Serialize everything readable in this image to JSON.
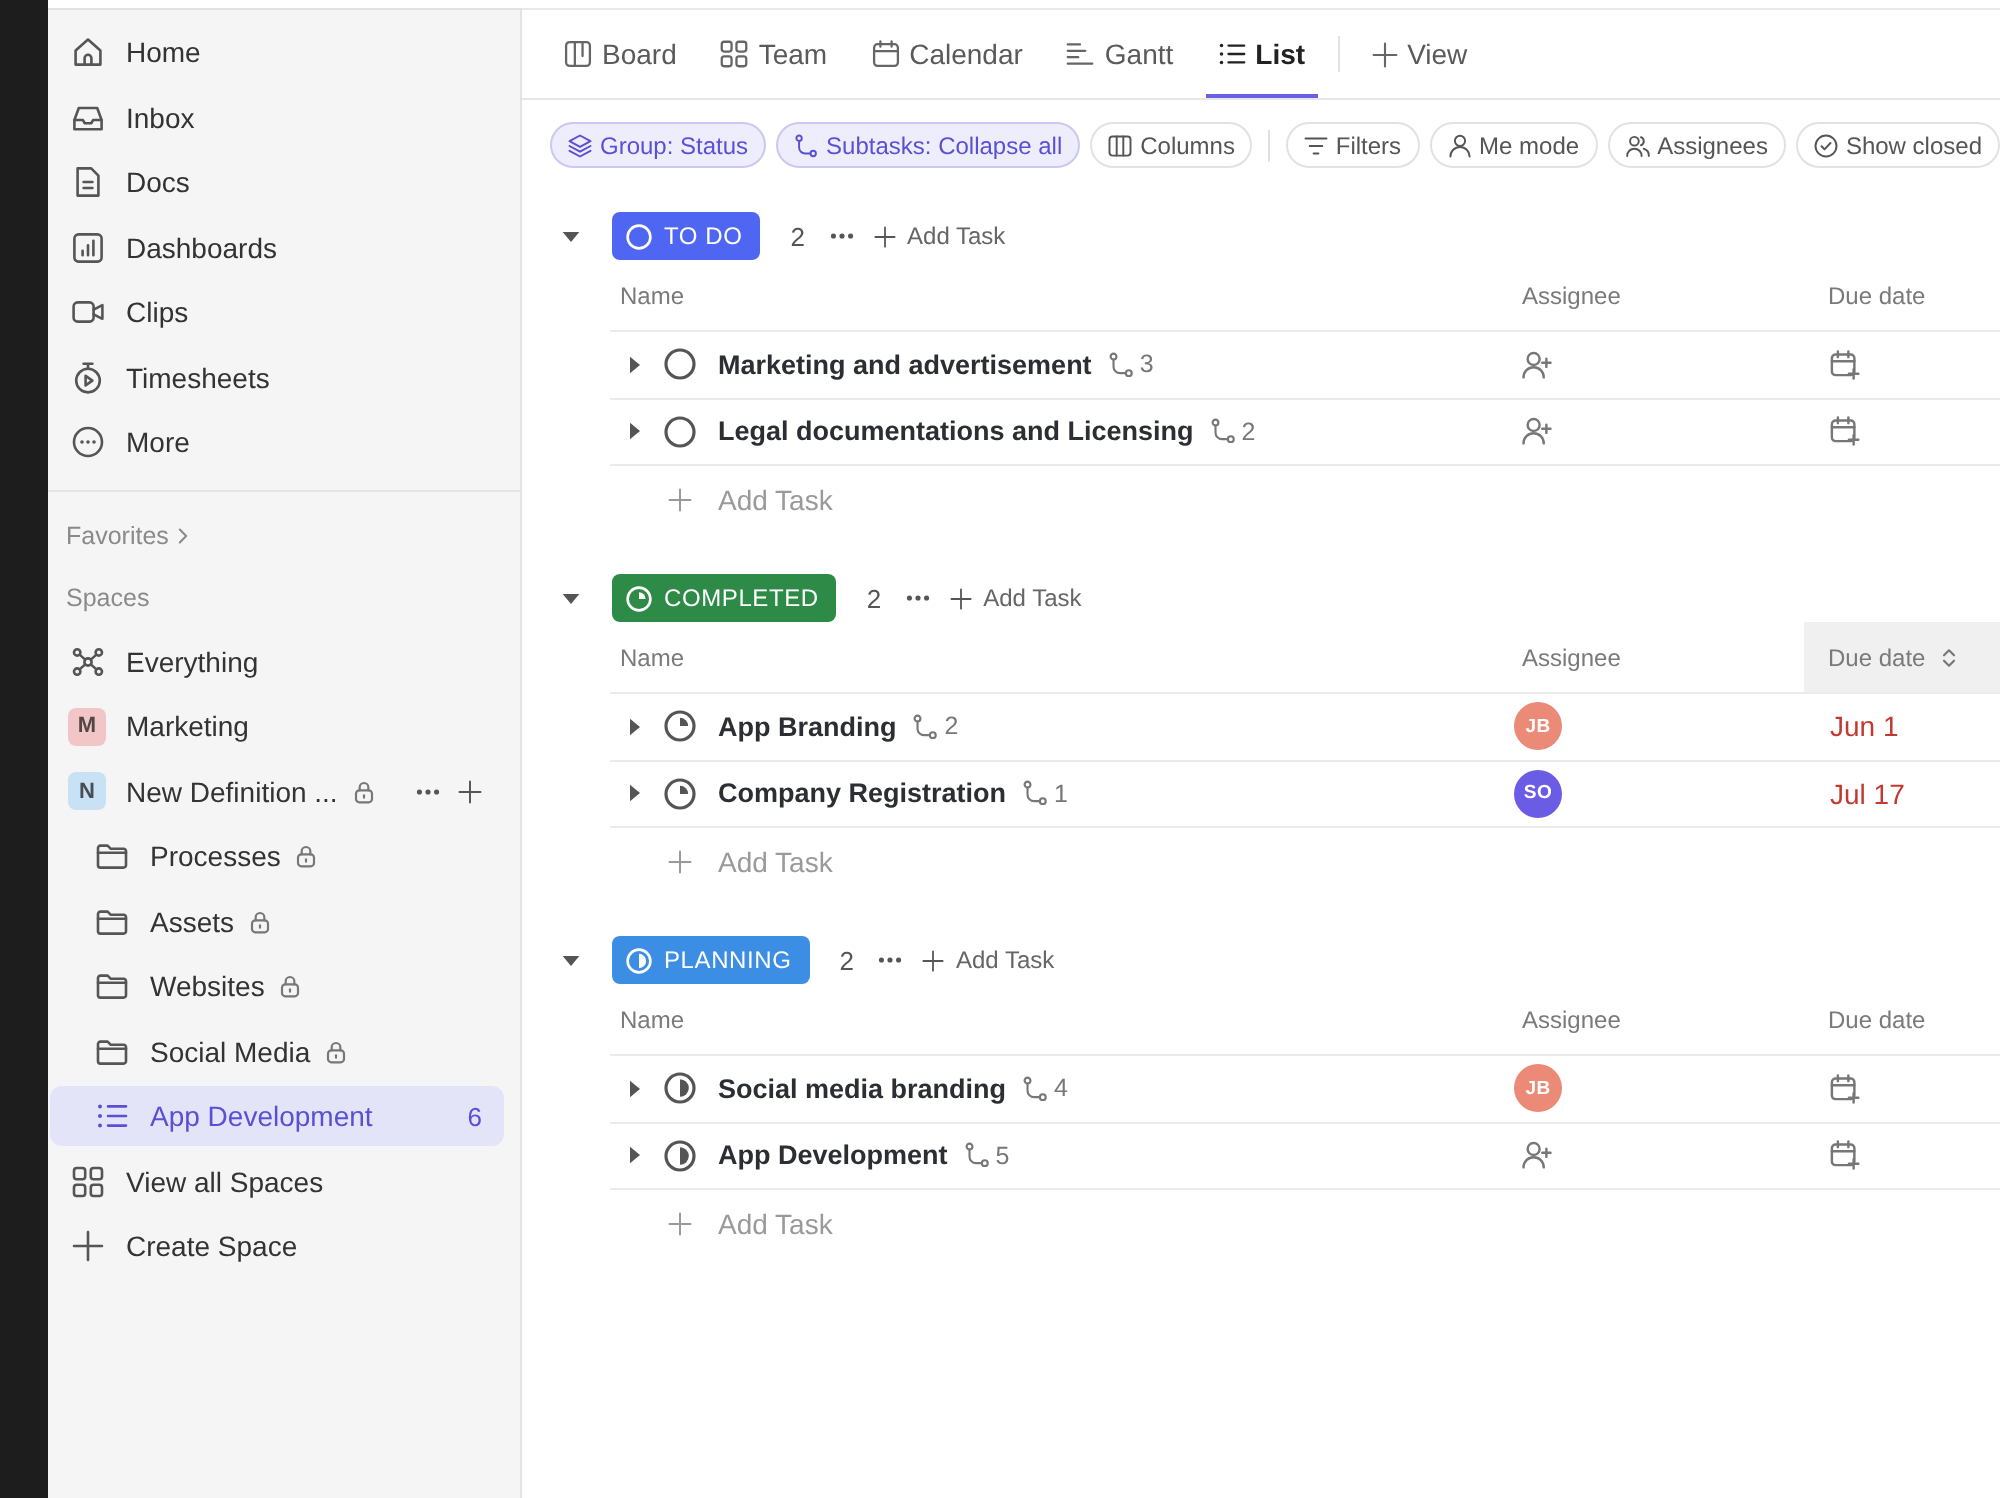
{
  "sidebar": {
    "nav": [
      {
        "label": "Home",
        "selected": false
      },
      {
        "label": "Inbox",
        "selected": false
      },
      {
        "label": "Docs",
        "selected": false
      },
      {
        "label": "Dashboards",
        "selected": false
      },
      {
        "label": "Clips",
        "selected": false
      },
      {
        "label": "Timesheets",
        "selected": false
      },
      {
        "label": "More",
        "selected": false
      }
    ],
    "favorites_label": "Favorites",
    "spaces_label": "Spaces",
    "spaces": [
      {
        "kind": "everything",
        "label": "Everything",
        "selected": false,
        "locked": false,
        "hovered": false
      },
      {
        "kind": "space",
        "label": "Marketing",
        "avatar": "M",
        "color": "#f2c6c6",
        "selected": false,
        "locked": false,
        "hovered": false
      },
      {
        "kind": "space",
        "label": "New Definition ...",
        "avatar": "N",
        "color": "#c8e1f5",
        "selected": false,
        "locked": true,
        "hovered": true,
        "children": [
          {
            "kind": "folder",
            "label": "Processes",
            "selected": false,
            "locked": true
          },
          {
            "kind": "folder",
            "label": "Assets",
            "selected": false,
            "locked": true
          },
          {
            "kind": "folder",
            "label": "Websites",
            "selected": false,
            "locked": true
          },
          {
            "kind": "folder",
            "label": "Social Media",
            "selected": false,
            "locked": true
          },
          {
            "kind": "list",
            "label": "App Development",
            "count": "6",
            "selected": true,
            "locked": false
          }
        ]
      }
    ],
    "actions": [
      {
        "label": "View all Spaces"
      },
      {
        "label": "Create Space"
      }
    ]
  },
  "main": {
    "tabs": [
      {
        "label": "Board",
        "selected": false
      },
      {
        "label": "Team",
        "selected": false
      },
      {
        "label": "Calendar",
        "selected": false
      },
      {
        "label": "Gantt",
        "selected": false
      },
      {
        "label": "List",
        "selected": true
      }
    ],
    "add_view": "View",
    "view_options": [
      {
        "label": "Group: Status",
        "active": true
      },
      {
        "label": "Subtasks: Collapse all",
        "active": true
      },
      {
        "label": "Columns",
        "active": false
      }
    ],
    "filters": [
      {
        "label": "Filters",
        "active": false
      },
      {
        "label": "Me mode",
        "active": false
      },
      {
        "label": "Assignees",
        "active": false
      },
      {
        "label": "Show closed",
        "active": false
      }
    ],
    "groups": [
      {
        "status": "TO DO",
        "kind": "empty",
        "color": "#4f66f3",
        "expanded": true,
        "count": "2",
        "add_task": "Add Task",
        "columns": [
          {
            "label": "Name",
            "highlighted": false
          },
          {
            "label": "Assignee",
            "highlighted": false
          },
          {
            "label": "Due date",
            "highlighted": false
          }
        ],
        "tasks": [
          {
            "name": "Marketing and advertisement",
            "subtasks": "3",
            "expanded": false
          },
          {
            "name": "Legal documentations and Licensing",
            "subtasks": "2",
            "expanded": false
          }
        ],
        "add_task_row": "Add Task"
      },
      {
        "status": "COMPLETED",
        "kind": "quarter",
        "color": "#2e8a47",
        "expanded": true,
        "count": "2",
        "add_task": "Add Task",
        "columns": [
          {
            "label": "Name",
            "highlighted": false
          },
          {
            "label": "Assignee",
            "highlighted": false
          },
          {
            "label": "Due date",
            "highlighted": true
          }
        ],
        "tasks": [
          {
            "name": "App Branding",
            "subtasks": "2",
            "expanded": false,
            "assignee": {
              "initials": "JB",
              "color": "#ec8a78"
            },
            "due": {
              "text": "Jun 1",
              "overdue": true
            }
          },
          {
            "name": "Company Registration",
            "subtasks": "1",
            "expanded": false,
            "assignee": {
              "initials": "SO",
              "color": "#6a5ce4"
            },
            "due": {
              "text": "Jul 17",
              "overdue": true
            }
          }
        ],
        "add_task_row": "Add Task"
      },
      {
        "status": "PLANNING",
        "kind": "half",
        "color": "#3b8ee4",
        "expanded": true,
        "count": "2",
        "add_task": "Add Task",
        "columns": [
          {
            "label": "Name",
            "highlighted": false
          },
          {
            "label": "Assignee",
            "highlighted": false
          },
          {
            "label": "Due date",
            "highlighted": false
          }
        ],
        "tasks": [
          {
            "name": "Social media branding",
            "subtasks": "4",
            "expanded": false,
            "assignee": {
              "initials": "JB",
              "color": "#ec8a78"
            }
          },
          {
            "name": "App Development",
            "subtasks": "5",
            "expanded": false
          }
        ],
        "add_task_row": "Add Task"
      }
    ]
  }
}
